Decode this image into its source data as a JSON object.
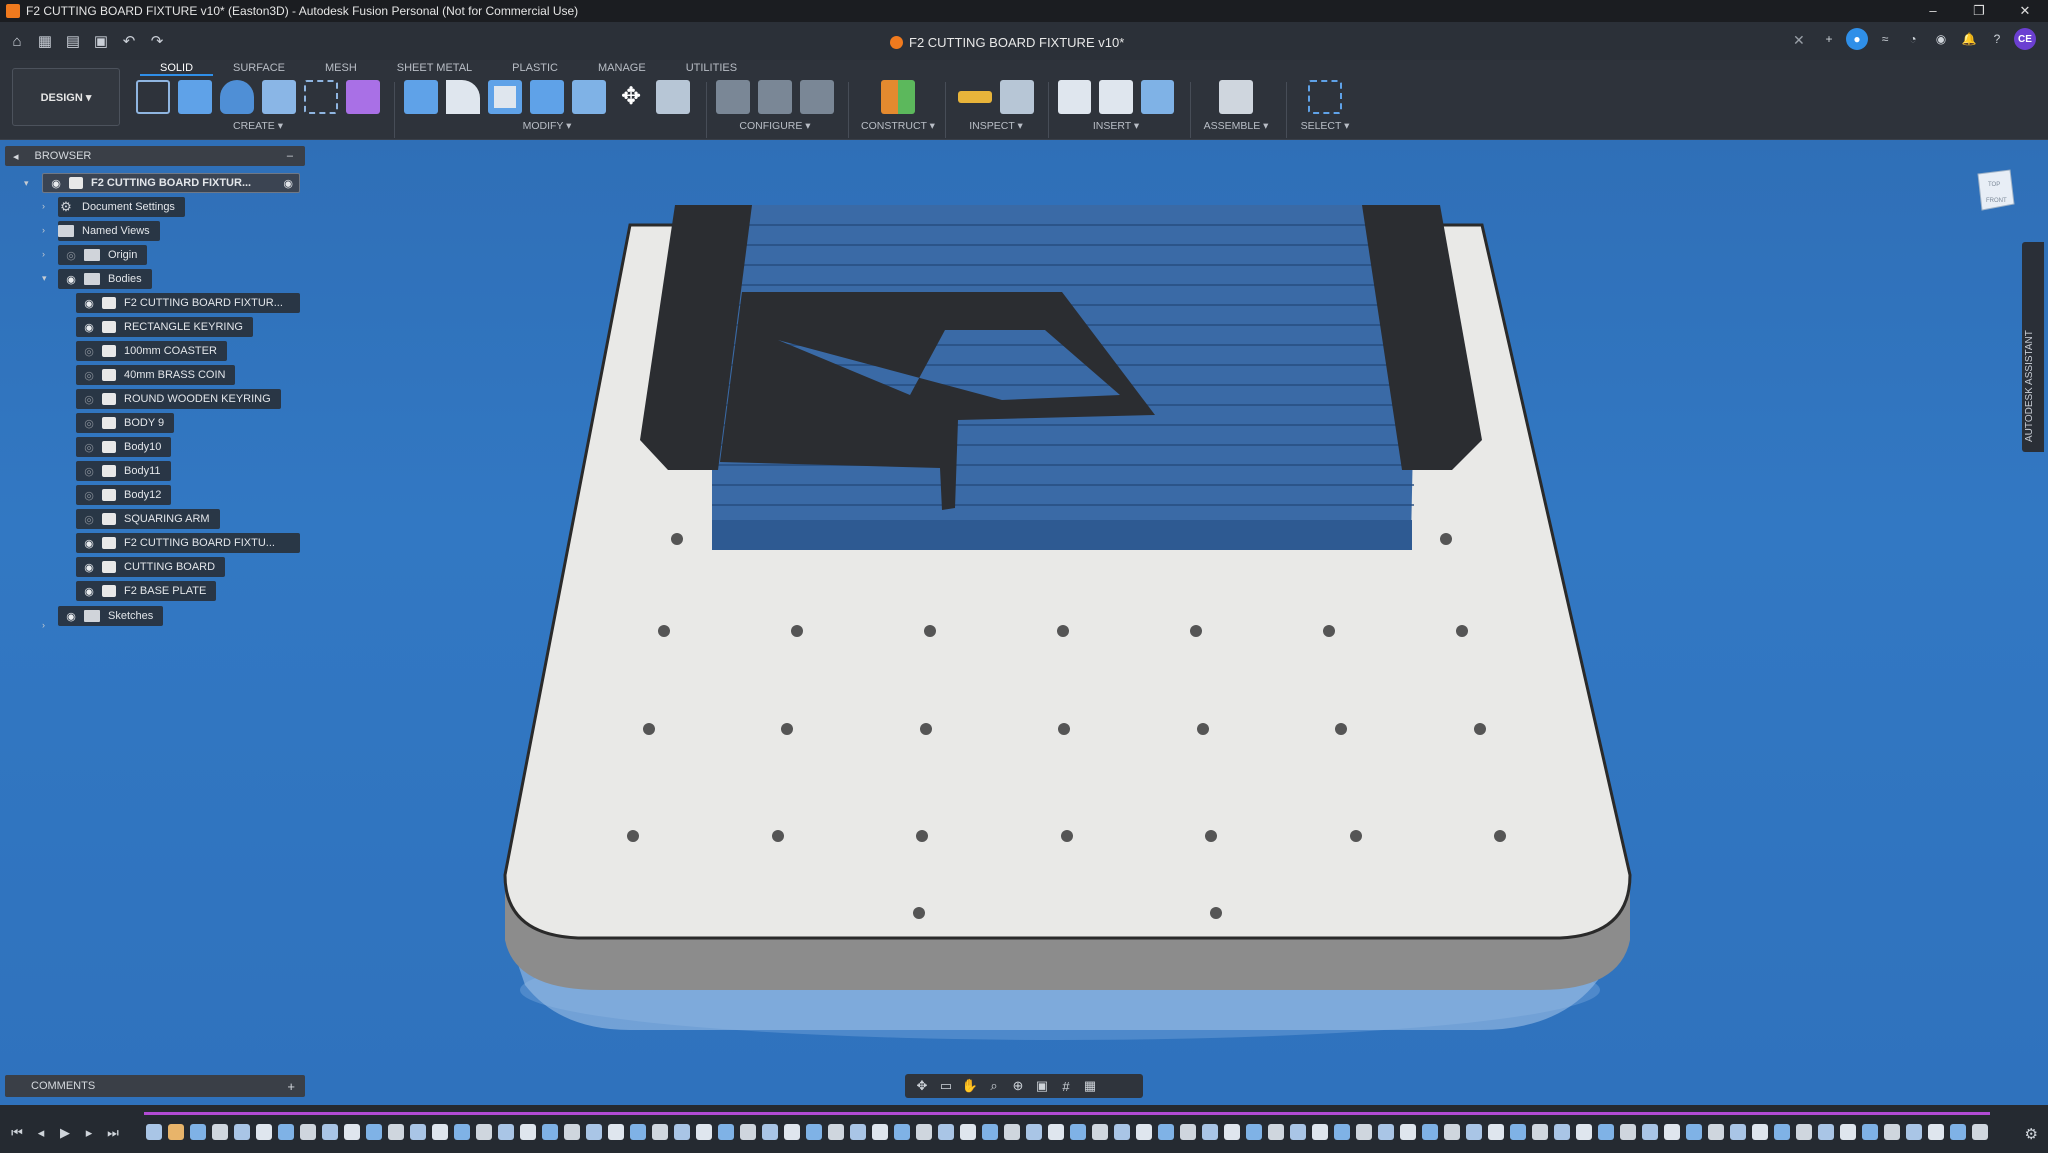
{
  "titlebar": {
    "title": "F2 CUTTING BOARD FIXTURE v10* (Easton3D) - Autodesk Fusion Personal (Not for Commercial Use)",
    "minimize": "–",
    "restore": "❐",
    "close": "✕"
  },
  "document_tab": {
    "label": "F2 CUTTING BOARD FIXTURE v10*",
    "close": "✕"
  },
  "user_avatar": "CE",
  "workspace": {
    "label": "DESIGN ▾"
  },
  "ribbon_tabs": [
    "SOLID",
    "SURFACE",
    "MESH",
    "SHEET METAL",
    "PLASTIC",
    "MANAGE",
    "UTILITIES"
  ],
  "ribbon_groups": {
    "create": "CREATE ▾",
    "modify": "MODIFY ▾",
    "configure": "CONFIGURE ▾",
    "construct": "CONSTRUCT ▾",
    "inspect": "INSPECT ▾",
    "insert": "INSERT ▾",
    "assemble": "ASSEMBLE ▾",
    "select": "SELECT ▾"
  },
  "browser": {
    "header": "BROWSER",
    "collapse": "–",
    "root": "F2 CUTTING BOARD FIXTUR...",
    "document_settings": "Document Settings",
    "named_views": "Named Views",
    "origin": "Origin",
    "bodies": "Bodies",
    "body_items": [
      "F2 CUTTING BOARD FIXTUR...",
      "RECTANGLE KEYRING",
      "100mm COASTER",
      "40mm BRASS COIN",
      "ROUND WOODEN KEYRING",
      "BODY 9",
      "Body10",
      "Body11",
      "Body12",
      "SQUARING ARM",
      "F2 CUTTING BOARD FIXTU...",
      "CUTTING BOARD",
      "F2 BASE PLATE"
    ],
    "sketches": "Sketches"
  },
  "comments": {
    "label": "COMMENTS",
    "add": "+"
  },
  "assistant": {
    "label": "AUTODESK ASSISTANT"
  },
  "viewcube": {
    "top": "TOP",
    "front": "FRONT"
  },
  "colors": {
    "viewport": "#3278c3",
    "plate": "#e9e9e7",
    "cutting_board": "#3a6aa6",
    "fixture": "#2b2d31",
    "accent_orange": "#f07a1e",
    "timeline_progress": "#b24bd4"
  }
}
